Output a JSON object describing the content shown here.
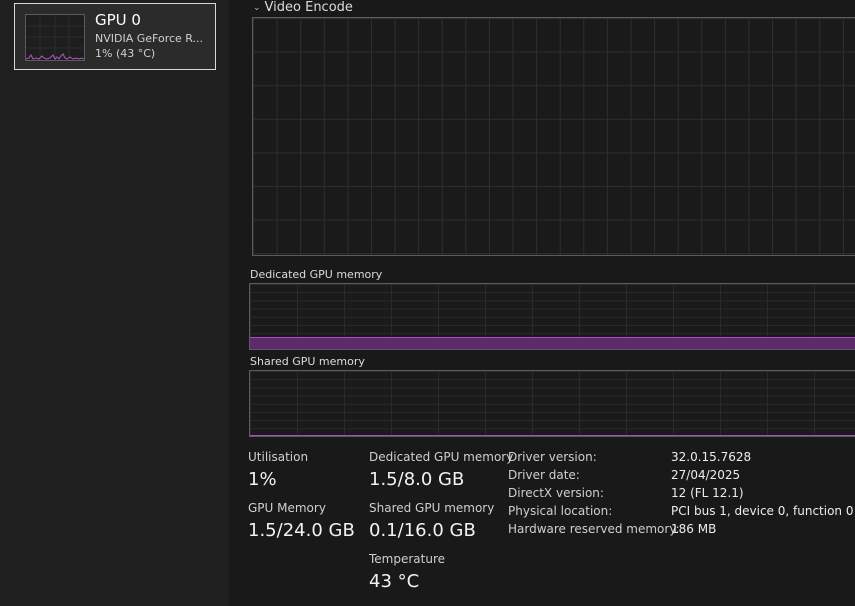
{
  "sidebar": {
    "device": {
      "title": "GPU 0",
      "subtitle": "NVIDIA GeForce R...",
      "value": "1% (43 °C)"
    }
  },
  "graphs": {
    "video_encode_label": "Video Encode",
    "dedicated_label": "Dedicated GPU memory",
    "shared_label": "Shared GPU memory",
    "dedicated_fill_fraction": 0.1875,
    "shared_fill_fraction": 0.00625
  },
  "stats": {
    "utilisation": {
      "label": "Utilisation",
      "value": "1%"
    },
    "gpu_memory": {
      "label": "GPU Memory",
      "value": "1.5/24.0 GB"
    },
    "dedicated_memory": {
      "label": "Dedicated GPU memory",
      "value": "1.5/8.0 GB"
    },
    "shared_memory": {
      "label": "Shared GPU memory",
      "value": "0.1/16.0 GB"
    },
    "temperature": {
      "label": "Temperature",
      "value": "43 °C"
    }
  },
  "info": {
    "driver_version": {
      "key": "Driver version:",
      "value": "32.0.15.7628"
    },
    "driver_date": {
      "key": "Driver date:",
      "value": "27/04/2025"
    },
    "directx_version": {
      "key": "DirectX version:",
      "value": "12 (FL 12.1)"
    },
    "physical_location": {
      "key": "Physical location:",
      "value": "PCI bus 1, device 0, function 0"
    },
    "hardware_reserved": {
      "key": "Hardware reserved memory:",
      "value": "186 MB"
    }
  },
  "colors": {
    "accent_purple": "#a64dbf",
    "fill_purple": "#5e2a6b"
  }
}
